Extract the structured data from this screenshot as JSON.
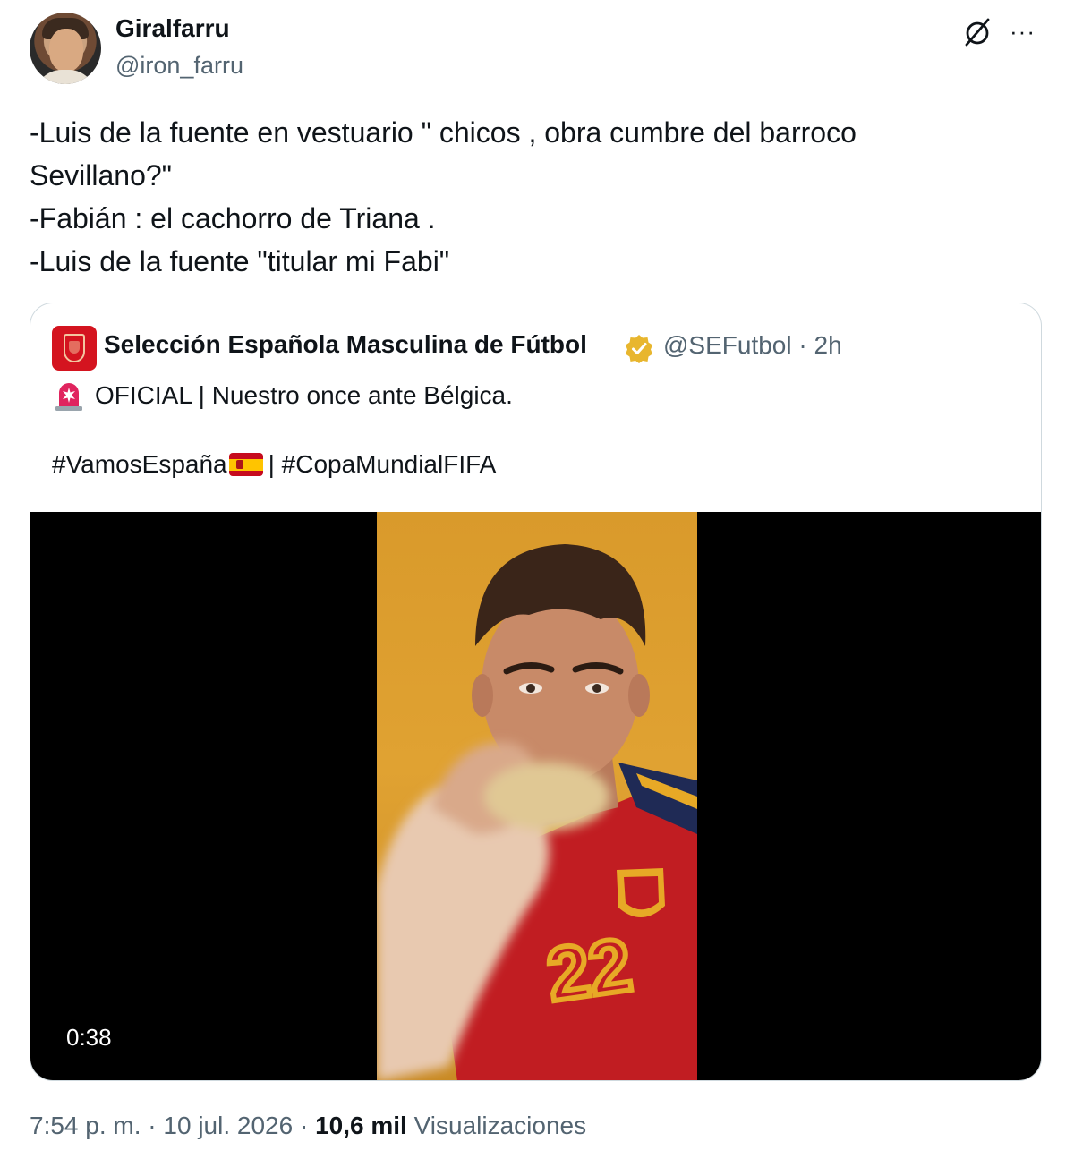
{
  "author": {
    "display_name": "Giralfarru",
    "handle": "@iron_farru",
    "avatar_icon": "user-avatar"
  },
  "header_actions": {
    "grok_icon": "grok-icon",
    "more_label": "···"
  },
  "tweet": {
    "lines": [
      "-Luis de la fuente en vestuario \" chicos , obra cumbre del barroco",
      "Sevillano?\"",
      "-Fabián : el cachorro de Triana .",
      "-Luis de la fuente \"titular mi Fabi\""
    ]
  },
  "quote": {
    "name": "Selección Española Masculina de Fútbol",
    "handle": "@SEFutbol",
    "separator": "·",
    "time": "2h",
    "line1": "OFICIAL | Nuestro once ante Bélgica.",
    "hashtag1": "#VamosEspaña",
    "line2_rest": " | #CopaMundialFIFA",
    "video_duration": "0:38",
    "colors": {
      "badge": "#e8b62e",
      "brand_red": "#d4141f"
    }
  },
  "meta": {
    "time": "7:54 p. m.",
    "sep1": "·",
    "date": "10 jul. 2026",
    "sep2": "·",
    "views_count": "10,6 mil",
    "views_label": "Visualizaciones"
  }
}
